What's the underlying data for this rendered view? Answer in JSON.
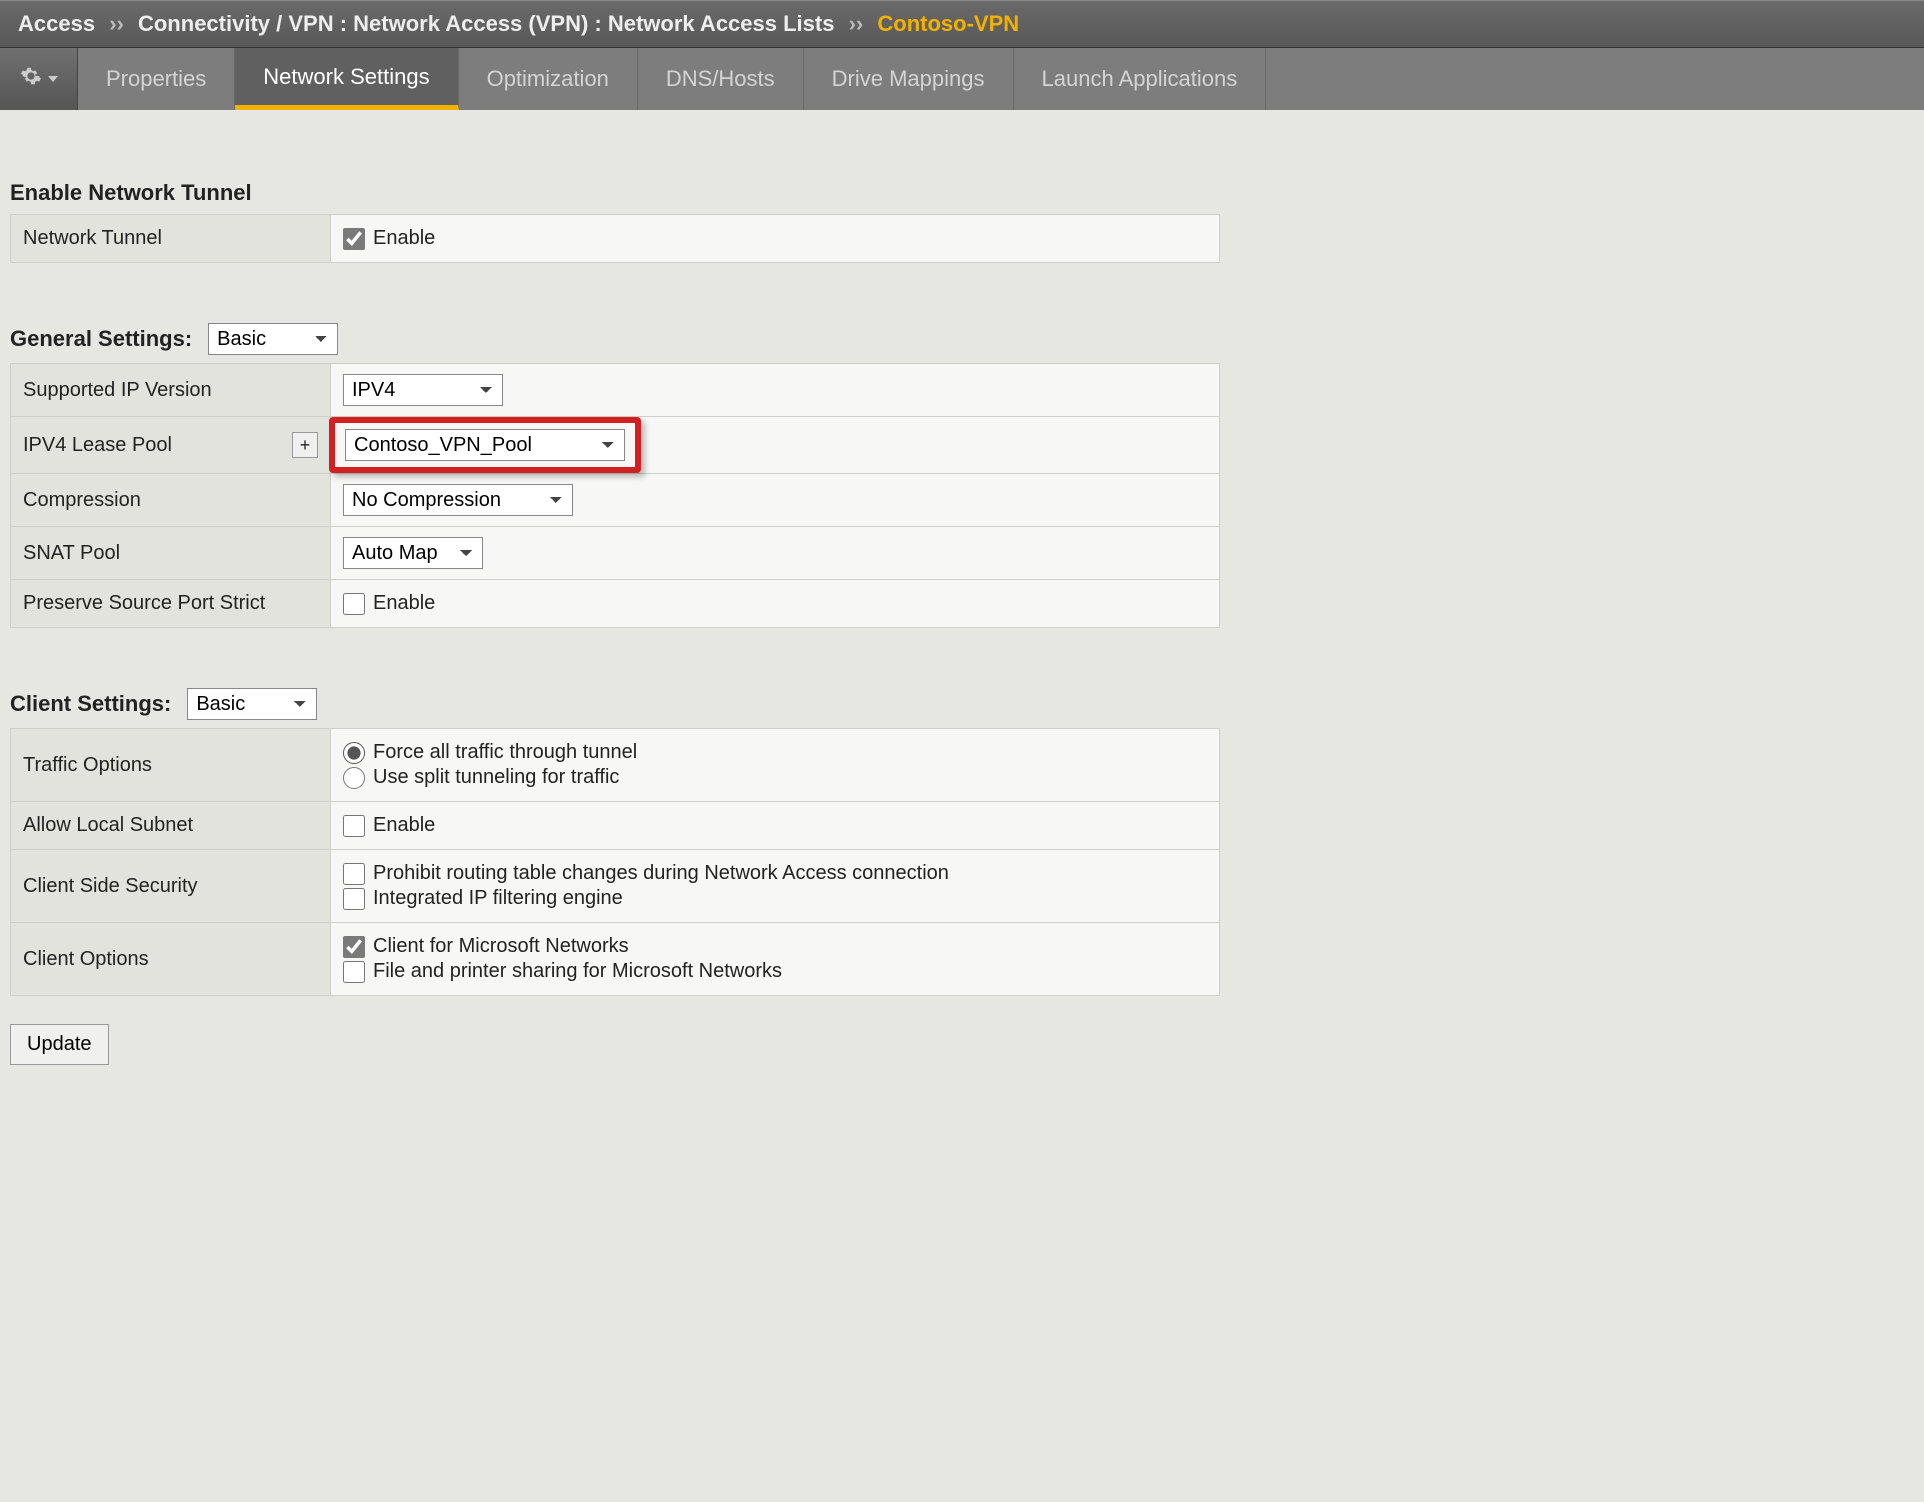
{
  "breadcrumb": {
    "root": "Access",
    "sep": "››",
    "path": "Connectivity / VPN : Network Access (VPN) : Network Access Lists",
    "leaf": "Contoso-VPN"
  },
  "tabs": [
    {
      "label": "Properties",
      "active": false
    },
    {
      "label": "Network Settings",
      "active": true
    },
    {
      "label": "Optimization",
      "active": false
    },
    {
      "label": "DNS/Hosts",
      "active": false
    },
    {
      "label": "Drive Mappings",
      "active": false
    },
    {
      "label": "Launch Applications",
      "active": false
    }
  ],
  "sections": {
    "enable_tunnel": {
      "title": "Enable Network Tunnel",
      "row_label": "Network Tunnel",
      "checkbox_label": "Enable",
      "checked": true
    },
    "general": {
      "title": "General Settings:",
      "mode": "Basic",
      "rows": {
        "ip_version": {
          "label": "Supported IP Version",
          "value": "IPV4"
        },
        "lease_pool": {
          "label": "IPV4 Lease Pool",
          "value": "Contoso_VPN_Pool",
          "plus": "+"
        },
        "compression": {
          "label": "Compression",
          "value": "No Compression"
        },
        "snat": {
          "label": "SNAT Pool",
          "value": "Auto Map"
        },
        "preserve_port": {
          "label": "Preserve Source Port Strict",
          "checkbox_label": "Enable",
          "checked": false
        }
      }
    },
    "client": {
      "title": "Client Settings:",
      "mode": "Basic",
      "rows": {
        "traffic": {
          "label": "Traffic Options",
          "options": [
            {
              "label": "Force all traffic through tunnel",
              "checked": true
            },
            {
              "label": "Use split tunneling for traffic",
              "checked": false
            }
          ]
        },
        "allow_local": {
          "label": "Allow Local Subnet",
          "checkbox_label": "Enable",
          "checked": false
        },
        "client_security": {
          "label": "Client Side Security",
          "options": [
            {
              "label": "Prohibit routing table changes during Network Access connection",
              "checked": false
            },
            {
              "label": "Integrated IP filtering engine",
              "checked": false
            }
          ]
        },
        "client_options": {
          "label": "Client Options",
          "options": [
            {
              "label": "Client for Microsoft Networks",
              "checked": true
            },
            {
              "label": "File and printer sharing for Microsoft Networks",
              "checked": false
            }
          ]
        }
      }
    }
  },
  "buttons": {
    "update": "Update"
  }
}
